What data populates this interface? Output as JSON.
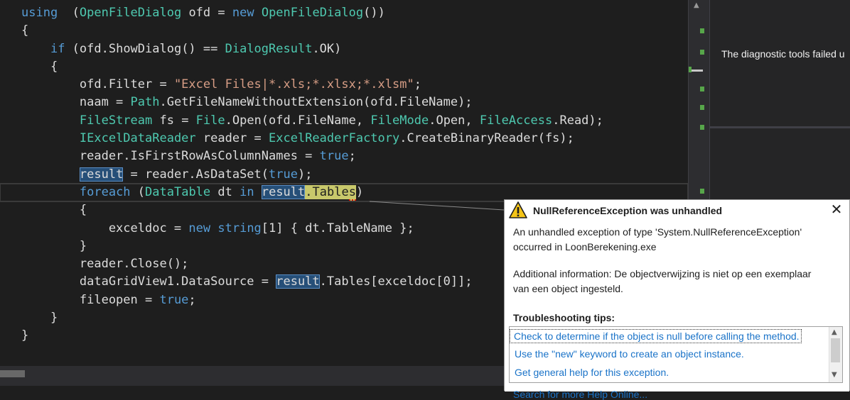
{
  "editor": {
    "lines": [
      [
        [
          "kw",
          "using"
        ],
        [
          "",
          "  ("
        ],
        [
          "ty",
          "OpenFileDialog"
        ],
        [
          "",
          " ofd = "
        ],
        [
          "kw",
          "new"
        ],
        [
          "",
          ""
        ],
        [
          "",
          " "
        ],
        [
          "ty",
          "OpenFileDialog"
        ],
        [
          "",
          "())"
        ]
      ],
      [
        [
          "",
          "{"
        ]
      ],
      [
        [
          "",
          "    "
        ],
        [
          "kw",
          "if"
        ],
        [
          "",
          " (ofd.ShowDialog() == "
        ],
        [
          "ty",
          "DialogResult"
        ],
        [
          "",
          ".OK)"
        ]
      ],
      [
        [
          "",
          "    {"
        ]
      ],
      [
        [
          "",
          "        ofd.Filter = "
        ],
        [
          "str",
          "\"Excel Files|*.xls;*.xlsx;*.xlsm\""
        ],
        [
          "",
          ";"
        ]
      ],
      [
        [
          "",
          "        naam = "
        ],
        [
          "ty",
          "Path"
        ],
        [
          "",
          ".GetFileNameWithoutExtension(ofd.FileName);"
        ]
      ],
      [
        [
          "",
          "        "
        ],
        [
          "ty",
          "FileStream"
        ],
        [
          "",
          " fs = "
        ],
        [
          "ty",
          "File"
        ],
        [
          "",
          ".Open(ofd.FileName, "
        ],
        [
          "ty",
          "FileMode"
        ],
        [
          "",
          ".Open, "
        ],
        [
          "ty",
          "FileAccess"
        ],
        [
          "",
          ".Read);"
        ]
      ],
      [
        [
          "",
          "        "
        ],
        [
          "ty",
          "IExcelDataReader"
        ],
        [
          "",
          " reader = "
        ],
        [
          "ty",
          "ExcelReaderFactory"
        ],
        [
          "",
          ".CreateBinaryReader(fs);"
        ]
      ],
      [
        [
          "",
          "        reader.IsFirstRowAsColumnNames = "
        ],
        [
          "kw",
          "true"
        ],
        [
          "",
          ";"
        ]
      ],
      [
        [
          "",
          "        "
        ],
        [
          "hl",
          "result"
        ],
        [
          "",
          " = reader.AsDataSet("
        ],
        [
          "kw",
          "true"
        ],
        [
          "",
          ");"
        ]
      ],
      [
        [
          "",
          "        "
        ],
        [
          "kw",
          "foreach"
        ],
        [
          "",
          " ("
        ],
        [
          "ty",
          "DataTable"
        ],
        [
          "",
          " dt "
        ],
        [
          "kw",
          "in"
        ],
        [
          "",
          " "
        ],
        [
          "hl2",
          "result"
        ],
        [
          "warn",
          ".Table"
        ],
        [
          "warnsq",
          "s"
        ],
        [
          "",
          ")"
        ]
      ],
      [
        [
          "",
          "        {"
        ]
      ],
      [
        [
          "",
          "            exceldoc = "
        ],
        [
          "kw",
          "new"
        ],
        [
          "",
          " "
        ],
        [
          "kw",
          "string"
        ],
        [
          "",
          "[1] { dt.TableName };"
        ]
      ],
      [
        [
          "",
          "        }"
        ]
      ],
      [
        [
          "",
          "        reader.Close();"
        ]
      ],
      [
        [
          "",
          "        dataGridView1.DataSource = "
        ],
        [
          "hl",
          "result"
        ],
        [
          "",
          ".Tables[exceldoc[0]];"
        ]
      ],
      [
        [
          "",
          "        fileopen = "
        ],
        [
          "kw",
          "true"
        ],
        [
          "",
          ";"
        ]
      ],
      [
        [
          "",
          "    }"
        ]
      ],
      [
        [
          "",
          "}"
        ]
      ]
    ],
    "current_line_index": 10
  },
  "diagnostics": {
    "message": "The diagnostic tools failed u"
  },
  "exception_popup": {
    "title": "NullReferenceException was unhandled",
    "description_line1": "An unhandled exception of type 'System.NullReferenceException'",
    "description_line2": "occurred in LoonBerekening.exe",
    "additional_line1": "Additional information: De objectverwijzing is niet op een exemplaar",
    "additional_line2": "van een object ingesteld.",
    "tips_heading": "Troubleshooting tips:",
    "tips": [
      "Check to determine if the object is null before calling the method.",
      "Use the \"new\" keyword to create an object instance.",
      "Get general help for this exception."
    ],
    "more_link": "Search for more Help Online...",
    "close_glyph": "✕"
  },
  "colors": {
    "keyword": "#569cd6",
    "type": "#4ec9b0",
    "string": "#d69d85",
    "link": "#1a73c8",
    "warning": "#f5c518"
  },
  "icons": {
    "warning": "warning-triangle-icon",
    "close": "close-icon"
  }
}
